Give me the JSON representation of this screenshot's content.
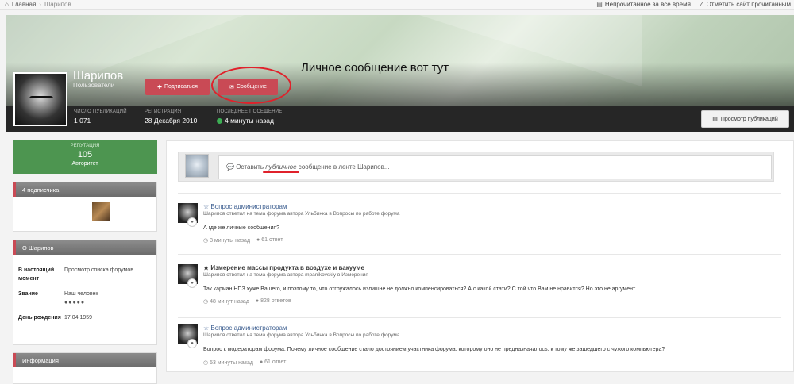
{
  "breadcrumb": {
    "home": "Главная",
    "current": "Шарипов"
  },
  "topbar": {
    "unread": "Непрочитанное за все время",
    "mark_read": "Отметить сайт прочитанным"
  },
  "profile": {
    "name": "Шарипов",
    "group": "Пользователи",
    "subscribe_label": "Подписаться",
    "message_label": "Сообщение",
    "annotation": "Личное сообщение вот тут",
    "stats": [
      {
        "label": "Число публикаций",
        "value": "1 071"
      },
      {
        "label": "Регистрация",
        "value": "28 Декабря 2010"
      },
      {
        "label": "Последнее посещение",
        "value": "4 минуты назад"
      }
    ],
    "view_posts_label": "Просмотр публикаций"
  },
  "reputation": {
    "label": "Репутация",
    "value": "105",
    "title": "Авторитет"
  },
  "followers": {
    "title": "4 подписчика"
  },
  "about": {
    "title": "О Шарипов",
    "rows": [
      {
        "key": "В настоящий момент",
        "value": "Просмотр списка форумов"
      },
      {
        "key": "Звание",
        "value": "Наш человек",
        "pips": "●●●●●"
      },
      {
        "key": "День рождения",
        "value": "17.04.1959"
      }
    ]
  },
  "info": {
    "title": "Информация"
  },
  "composer": {
    "prefix": "Оставить ",
    "emph": "публичное",
    "suffix": " сообщение в ленте Шарипов..."
  },
  "feed": [
    {
      "title": "Вопрос администраторам",
      "meta": "Шарипов ответил на тема форума автора Ульбинка в Вопросы по работе форума",
      "body": "А где же личные сообщения?",
      "time": "3 минуты назад",
      "replies": "61 ответ"
    },
    {
      "title": "Измерение массы продукта в воздухе и вакууме",
      "meta": "Шарипов ответил на тема форума автора mpanikovskiy в Измерения",
      "body": "Так карман НПЗ хуже Вашего, и поэтому то, что отгружалось излишне не должно компенсироваться? А с какой стати? С той что Вам не нравится? Но это не аргумент.",
      "time": "48 минут назад",
      "replies": "828 ответов"
    },
    {
      "title": "Вопрос администраторам",
      "meta": "Шарипов ответил на тема форума автора Ульбинка в Вопросы по работе форума",
      "body": "Вопрос к модераторам форума: Почему личное сообщение стало достоянием участника форума, которому оно не предназначалось, к тому же зашедшего с чужого компьютера?",
      "time": "53 минуты назад",
      "replies": "61 ответ"
    }
  ]
}
